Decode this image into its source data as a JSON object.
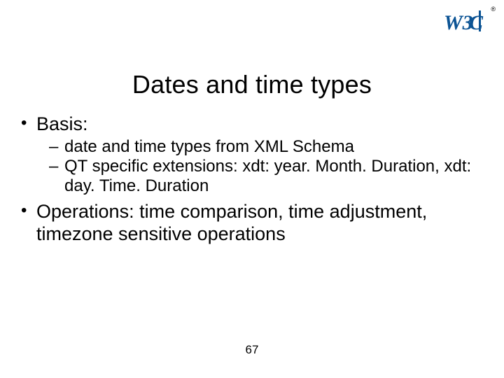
{
  "logo": {
    "name": "w3c-logo",
    "reg": "®",
    "colors": {
      "w3": "#0b5394",
      "c": "#0b5394",
      "bars": "#0b5394"
    }
  },
  "title": "Dates and time types",
  "bullets": [
    {
      "text": "Basis:",
      "sub": [
        "date and time types from XML Schema",
        "QT specific extensions: xdt: year. Month. Duration, xdt: day. Time. Duration"
      ]
    },
    {
      "text": "Operations: time comparison, time adjustment, timezone sensitive operations",
      "sub": []
    }
  ],
  "page_number": "67"
}
